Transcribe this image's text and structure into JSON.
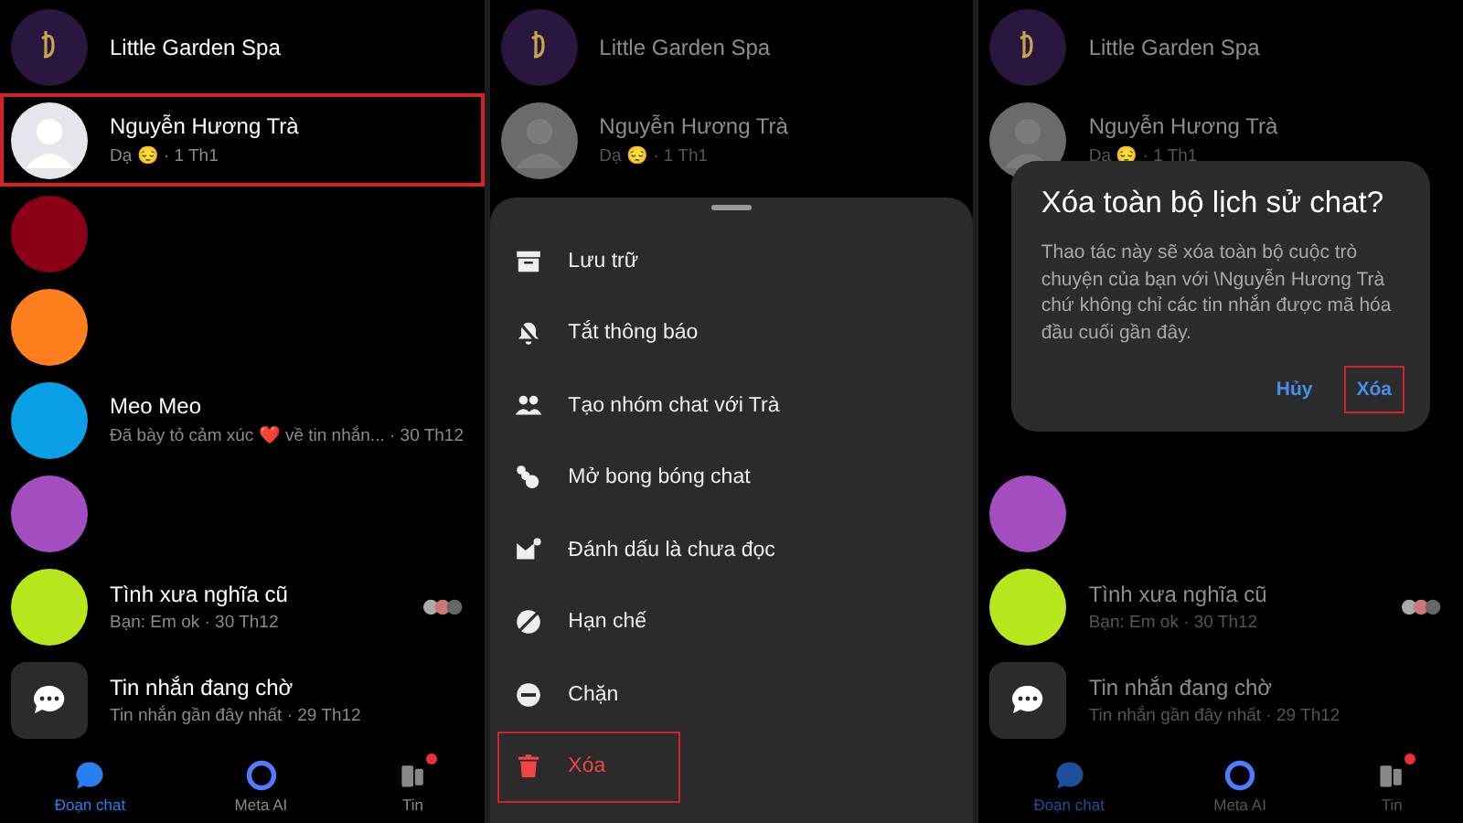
{
  "panels": [
    {
      "kind": "chat_list",
      "dimmed": false,
      "chats": [
        {
          "kind": "logo",
          "name": "Little Garden Spa",
          "highlighted": false
        },
        {
          "kind": "person",
          "name": "Nguyễn Hương Trà",
          "preview": "Dạ 😔 · 1 Th1",
          "highlighted": true
        },
        {
          "kind": "color",
          "color": "#8b0016",
          "highlighted": false
        },
        {
          "kind": "color",
          "color": "#ff7f1f",
          "highlighted": false
        },
        {
          "kind": "color",
          "color": "#0aa0e6",
          "name": "Meo Meo",
          "preview": "Đã bày tỏ cảm xúc ❤️ về tin nhắn... · 30 Th12",
          "highlighted": false
        },
        {
          "kind": "color",
          "color": "#a44dc0",
          "highlighted": false
        },
        {
          "kind": "color",
          "color": "#b8e61c",
          "name": "Tình xưa nghĩa cũ",
          "preview": "Bạn: Em ok · 30 Th12",
          "group_seen": true,
          "highlighted": false
        },
        {
          "kind": "pending",
          "name": "Tin nhắn đang chờ",
          "preview": "Tin nhắn gần đây nhất · 29 Th12",
          "highlighted": false
        }
      ],
      "nav": [
        {
          "label": "Đoạn chat",
          "selected": true,
          "badge": false
        },
        {
          "label": "Meta AI",
          "selected": false,
          "badge": false
        },
        {
          "label": "Tin",
          "selected": false,
          "badge": true
        }
      ]
    },
    {
      "kind": "action_sheet",
      "dimmed": true,
      "chats": [
        {
          "kind": "logo",
          "name": "Little Garden Spa",
          "highlighted": false
        },
        {
          "kind": "person",
          "name": "Nguyễn Hương Trà",
          "preview": "Dạ 😔 · 1 Th1",
          "highlighted": false
        }
      ],
      "actions": [
        {
          "label": "Lưu trữ",
          "destructive": false,
          "highlighted": false
        },
        {
          "label": "Tắt thông báo",
          "destructive": false,
          "highlighted": false
        },
        {
          "label": "Tạo nhóm chat với Trà",
          "destructive": false,
          "highlighted": false
        },
        {
          "label": "Mở bong bóng chat",
          "destructive": false,
          "highlighted": false
        },
        {
          "label": "Đánh dấu là chưa đọc",
          "destructive": false,
          "highlighted": false
        },
        {
          "label": "Hạn chế",
          "destructive": false,
          "highlighted": false
        },
        {
          "label": "Chặn",
          "destructive": false,
          "highlighted": false
        },
        {
          "label": "Xóa",
          "destructive": true,
          "highlighted": true
        }
      ]
    },
    {
      "kind": "confirm_dialog",
      "dimmed": true,
      "chats": [
        {
          "kind": "logo",
          "name": "Little Garden Spa",
          "highlighted": false
        },
        {
          "kind": "person",
          "name": "Nguyễn Hương Trà",
          "preview": "Dạ 😔 · 1 Th1",
          "highlighted": false
        },
        {
          "kind": "hidden"
        },
        {
          "kind": "hidden"
        },
        {
          "kind": "hidden"
        },
        {
          "kind": "color",
          "color": "#a44dc0",
          "highlighted": false
        },
        {
          "kind": "color",
          "color": "#b8e61c",
          "name": "Tình xưa nghĩa cũ",
          "preview": "Bạn: Em ok · 30 Th12",
          "group_seen": true,
          "highlighted": false
        },
        {
          "kind": "pending",
          "name": "Tin nhắn đang chờ",
          "preview": "Tin nhắn gần đây nhất · 29 Th12",
          "highlighted": false
        }
      ],
      "dialog": {
        "title": "Xóa toàn bộ lịch sử chat?",
        "message": "Thao tác này sẽ xóa toàn bộ cuộc trò chuyện của bạn với \\Nguyễn Hương Trà chứ không chỉ các tin nhắn được mã hóa đầu cuối gần đây.",
        "buttons": [
          {
            "label": "Hủy",
            "highlighted": false
          },
          {
            "label": "Xóa",
            "highlighted": true
          }
        ]
      },
      "nav": [
        {
          "label": "Đoạn chat",
          "selected": true,
          "badge": false
        },
        {
          "label": "Meta AI",
          "selected": false,
          "badge": false
        },
        {
          "label": "Tin",
          "selected": false,
          "badge": true
        }
      ]
    }
  ]
}
